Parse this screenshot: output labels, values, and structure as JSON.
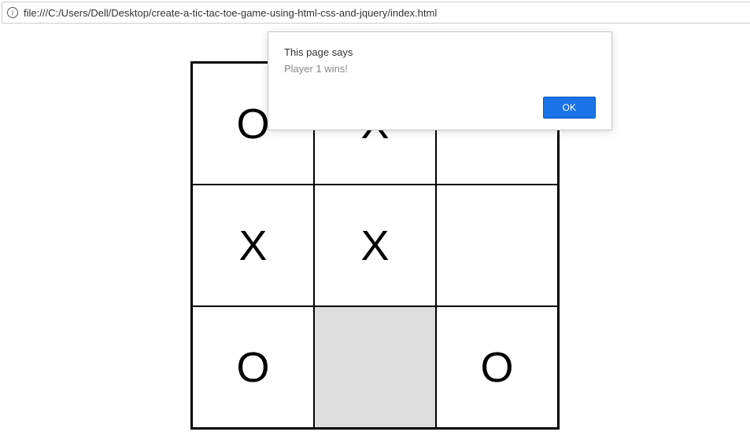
{
  "address_bar": {
    "url": "file:///C:/Users/Dell/Desktop/create-a-tic-tac-toe-game-using-html-css-and-jquery/index.html"
  },
  "alert": {
    "title": "This page says",
    "message": "Player 1 wins!",
    "ok_label": "OK"
  },
  "board": {
    "cells": [
      {
        "value": "O",
        "hovered": false
      },
      {
        "value": "X",
        "hovered": false
      },
      {
        "value": "",
        "hovered": false
      },
      {
        "value": "X",
        "hovered": false
      },
      {
        "value": "X",
        "hovered": false
      },
      {
        "value": "",
        "hovered": false
      },
      {
        "value": "O",
        "hovered": false
      },
      {
        "value": "",
        "hovered": true
      },
      {
        "value": "O",
        "hovered": false
      }
    ]
  }
}
